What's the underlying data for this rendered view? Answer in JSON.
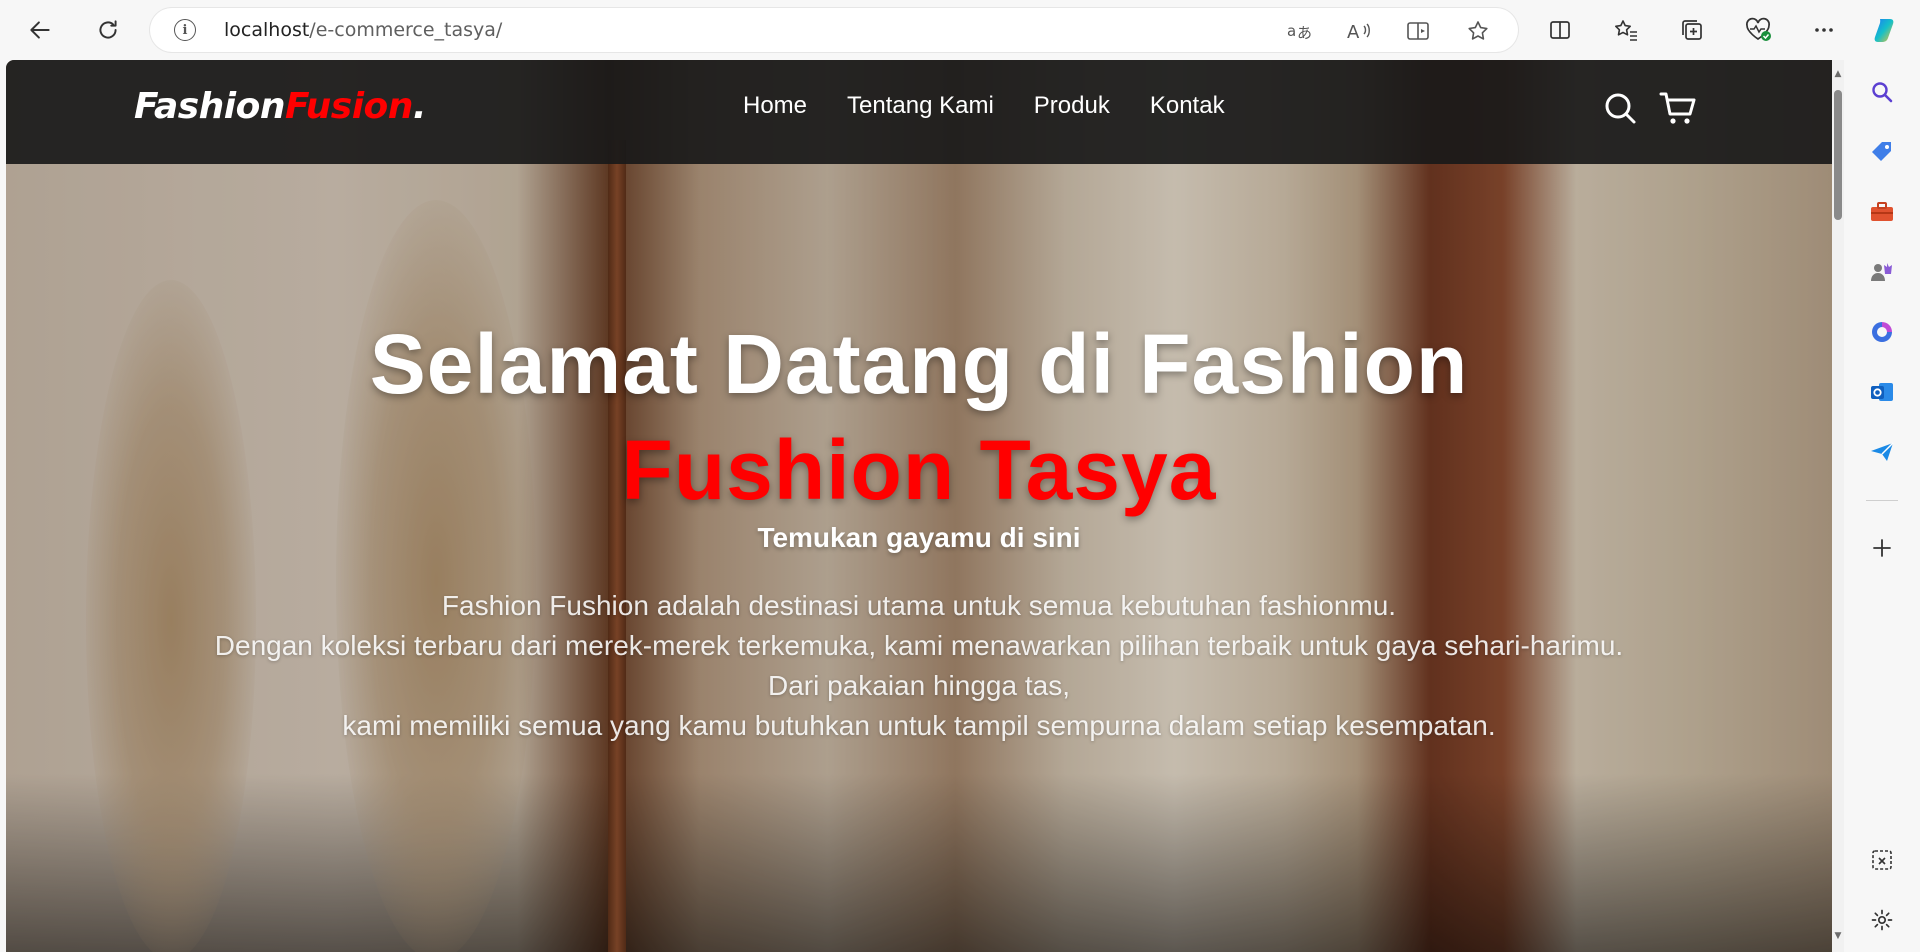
{
  "browser": {
    "url_host": "localhost",
    "url_path": "/e-commerce_tasya/"
  },
  "site": {
    "logo_part1": "Fashion",
    "logo_part2": "Fusion",
    "logo_dot": ".",
    "nav": [
      "Home",
      "Tentang Kami",
      "Produk",
      "Kontak"
    ]
  },
  "hero": {
    "title_line1": "Selamat Datang di Fashion",
    "title_line2": "Fushion Tasya",
    "subtitle": "Temukan gayamu di sini",
    "desc_lines": [
      "Fashion Fushion adalah destinasi utama untuk semua kebutuhan fashionmu.",
      "Dengan koleksi terbaru dari merek-merek terkemuka, kami menawarkan pilihan terbaik untuk gaya sehari-harimu.",
      "Dari pakaian hingga tas,",
      "kami memiliki semua yang kamu butuhkan untuk tampil sempurna dalam setiap kesempatan."
    ]
  },
  "colors": {
    "accent": "#ff0000",
    "navbar": "#191919"
  }
}
